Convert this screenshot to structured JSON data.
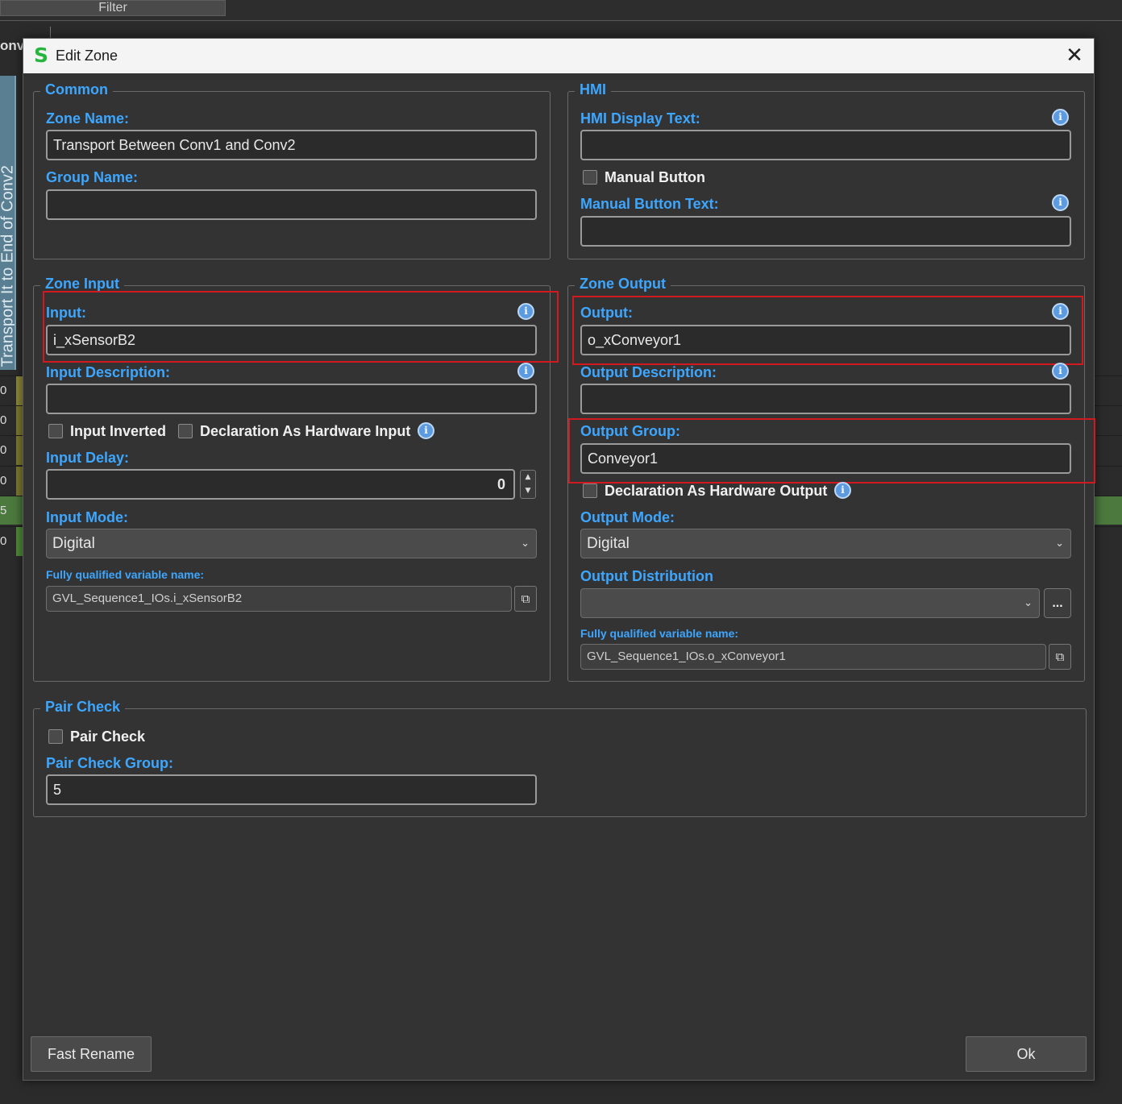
{
  "background": {
    "filter_label": "Filter",
    "conv_label": "onv",
    "side_panel_text": "Transport It to End of Conv2",
    "row_numbers": [
      "0",
      "0",
      "0",
      "0",
      "5",
      "0"
    ]
  },
  "dialog": {
    "title": "Edit Zone",
    "logo": "S",
    "close_glyph": "✕"
  },
  "common": {
    "legend": "Common",
    "zone_name_label": "Zone Name:",
    "zone_name_value": "Transport Between Conv1 and Conv2",
    "group_name_label": "Group Name:",
    "group_name_value": ""
  },
  "hmi": {
    "legend": "HMI",
    "display_text_label": "HMI Display Text:",
    "display_text_value": "",
    "manual_button_label": "Manual Button",
    "manual_button_text_label": "Manual Button Text:",
    "manual_button_text_value": ""
  },
  "zone_input": {
    "legend": "Zone Input",
    "input_label": "Input:",
    "input_value": "i_xSensorB2",
    "description_label": "Input Description:",
    "description_value": "",
    "inverted_label": "Input Inverted",
    "hardware_label": "Declaration As Hardware Input",
    "delay_label": "Input Delay:",
    "delay_value": "0",
    "mode_label": "Input Mode:",
    "mode_value": "Digital",
    "fqn_label": "Fully qualified variable name:",
    "fqn_value": "GVL_Sequence1_IOs.i_xSensorB2"
  },
  "zone_output": {
    "legend": "Zone Output",
    "output_label": "Output:",
    "output_value": "o_xConveyor1",
    "description_label": "Output Description:",
    "description_value": "",
    "group_label": "Output Group:",
    "group_value": "Conveyor1",
    "hardware_label": "Declaration As Hardware Output",
    "mode_label": "Output Mode:",
    "mode_value": "Digital",
    "distribution_label": "Output Distribution",
    "distribution_value": "",
    "dots_label": "...",
    "fqn_label": "Fully qualified variable name:",
    "fqn_value": "GVL_Sequence1_IOs.o_xConveyor1"
  },
  "pair_check": {
    "legend": "Pair Check",
    "checkbox_label": "Pair Check",
    "group_label": "Pair Check Group:",
    "group_value": "5"
  },
  "footer": {
    "fast_rename_label": "Fast Rename",
    "ok_label": "Ok"
  },
  "icons": {
    "info": "i",
    "copy": "⧉",
    "chevron": "⌄",
    "spin_up": "▲",
    "spin_down": "▼"
  },
  "colors": {
    "accent_label": "#3da6ff",
    "highlight_box": "#d2191f",
    "logo_green": "#27b43f",
    "dialog_bg": "#333333"
  }
}
